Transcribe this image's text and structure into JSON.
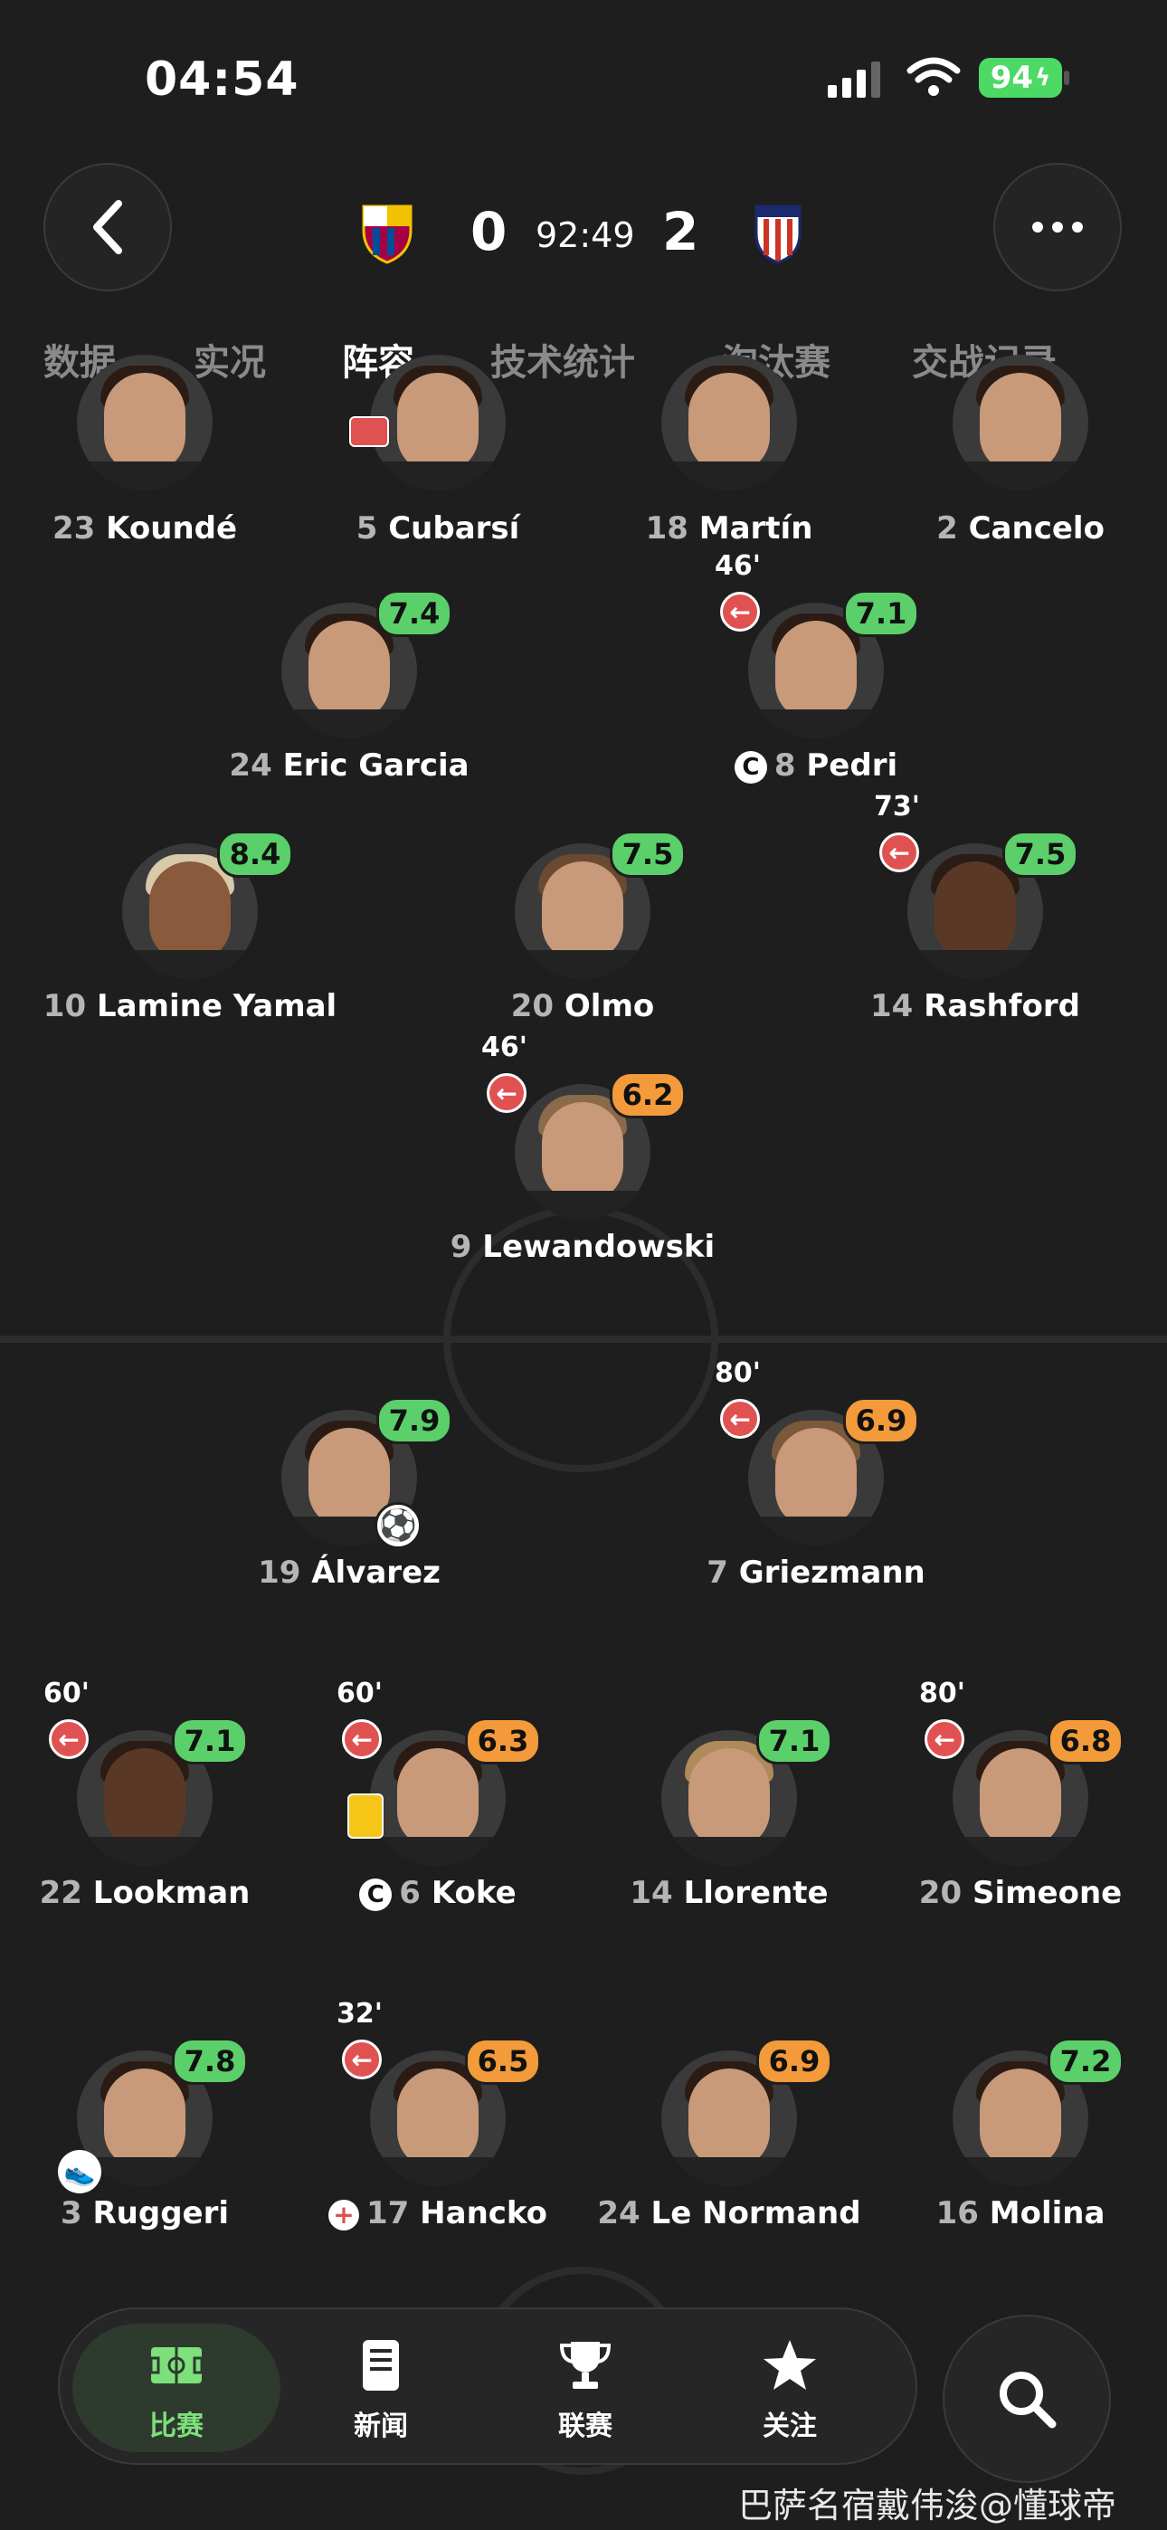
{
  "status": {
    "time": "04:54",
    "battery": "94"
  },
  "match": {
    "home_score": "0",
    "away_score": "2",
    "clock": "92:49"
  },
  "tabs": [
    "数据",
    "实况",
    "阵容",
    "技术统计",
    "淘汰赛",
    "交战记录"
  ],
  "players": [
    {
      "num": "23",
      "name": "Koundé"
    },
    {
      "num": "5",
      "name": "Cubarsí"
    },
    {
      "num": "18",
      "name": "Martín"
    },
    {
      "num": "2",
      "name": "Cancelo"
    },
    {
      "num": "24",
      "name": "Eric Garcia",
      "rating": "7.4"
    },
    {
      "num": "8",
      "name": "Pedri",
      "rating": "7.1",
      "sub_min": "46'"
    },
    {
      "num": "10",
      "name": "Lamine Yamal",
      "rating": "8.4"
    },
    {
      "num": "20",
      "name": "Olmo",
      "rating": "7.5"
    },
    {
      "num": "14",
      "name": "Rashford",
      "rating": "7.5",
      "sub_min": "73'"
    },
    {
      "num": "9",
      "name": "Lewandowski",
      "rating": "6.2",
      "sub_min": "46'"
    },
    {
      "num": "19",
      "name": "Álvarez",
      "rating": "7.9"
    },
    {
      "num": "7",
      "name": "Griezmann",
      "rating": "6.9",
      "sub_min": "80'"
    },
    {
      "num": "22",
      "name": "Lookman",
      "rating": "7.1",
      "sub_min": "60'"
    },
    {
      "num": "6",
      "name": "Koke",
      "rating": "6.3",
      "sub_min": "60'"
    },
    {
      "num": "14",
      "name": "Llorente",
      "rating": "7.1"
    },
    {
      "num": "20",
      "name": "Simeone",
      "rating": "6.8",
      "sub_min": "80'"
    },
    {
      "num": "3",
      "name": "Ruggeri",
      "rating": "7.8"
    },
    {
      "num": "17",
      "name": "Hancko",
      "rating": "6.5",
      "sub_min": "32'"
    },
    {
      "num": "24",
      "name": "Le Normand",
      "rating": "6.9"
    },
    {
      "num": "16",
      "name": "Molina",
      "rating": "7.2"
    }
  ],
  "nav": {
    "match": "比赛",
    "news": "新闻",
    "league": "联赛",
    "follow": "关注"
  },
  "watermark": "巴萨名宿戴伟浚@懂球帝",
  "colors": {
    "rating_good": "#5bd06a",
    "rating_mid": "#f39a3a",
    "sub_off": "#e05252",
    "nav_active": "#7ee07a"
  }
}
